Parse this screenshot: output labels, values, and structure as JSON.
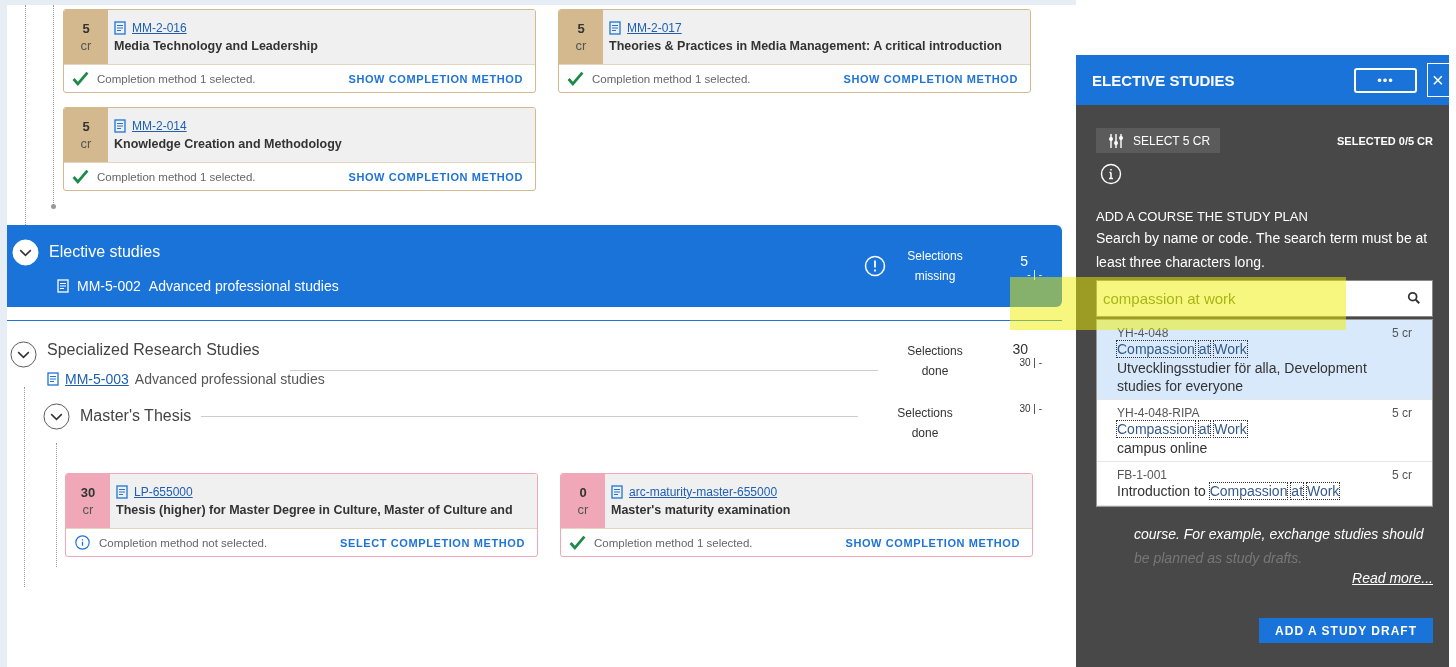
{
  "top_group": {
    "cards": [
      {
        "credits": "5",
        "unit": "cr",
        "code": "MM-2-016",
        "title": "Media Technology and Leadership",
        "color": "#d4b98e",
        "completion_selected": true,
        "status": "Completion method 1 selected.",
        "action": "SHOW COMPLETION METHOD"
      },
      {
        "credits": "5",
        "unit": "cr",
        "code": "MM-2-017",
        "title": "Theories & Practices in Media Management: A critical introduction",
        "color": "#d4b98e",
        "completion_selected": true,
        "status": "Completion method 1 selected.",
        "action": "SHOW COMPLETION METHOD"
      },
      {
        "credits": "5",
        "unit": "cr",
        "code": "MM-2-014",
        "title": "Knowledge Creation and Methodology",
        "color": "#d4b98e",
        "completion_selected": true,
        "status": "Completion method 1 selected.",
        "action": "SHOW COMPLETION METHOD"
      }
    ]
  },
  "elective": {
    "title": "Elective studies",
    "code": "MM-5-002",
    "name": "Advanced professional studies",
    "status": "Selections missing",
    "credits": "5",
    "range": "- | -"
  },
  "specialized": {
    "title": "Specialized Research Studies",
    "code": "MM-5-003",
    "name": "Advanced professional studies",
    "status": "Selections done",
    "credits": "30",
    "range": "30 | -",
    "children": [
      {
        "title": "Master's Thesis",
        "status": "Selections done",
        "range": "30 | -",
        "cards": [
          {
            "credits": "30",
            "unit": "cr",
            "code": "LP-655000",
            "title": "Thesis (higher) for Master Degree in Culture, Master of Culture and",
            "color": "#f0a8b8",
            "completion_selected": false,
            "status": "Completion method not selected.",
            "action": "SELECT COMPLETION METHOD"
          },
          {
            "credits": "0",
            "unit": "cr",
            "code": "arc-maturity-master-655000",
            "title": "Master's maturity examination",
            "color": "#f0a8b8",
            "completion_selected": true,
            "status": "Completion method 1 selected.",
            "action": "SHOW COMPLETION METHOD"
          }
        ]
      }
    ]
  },
  "panel": {
    "title": "ELECTIVE STUDIES",
    "more_button": "•••",
    "close_button": "×",
    "select_button": "SELECT 5 CR",
    "selected_count": "SELECTED 0/5 CR",
    "add_heading": "ADD A COURSE THE STUDY PLAN",
    "add_hint": "Search by name or code. The search term must be at least three characters long.",
    "search": {
      "value": "compassion at work"
    },
    "results": [
      {
        "code": "YH-4-048",
        "credits": "5 cr",
        "title": [
          {
            "text": "Compassion",
            "match": true
          },
          {
            "text": "at",
            "match": true
          },
          {
            "text": "Work",
            "match": true
          }
        ],
        "subtitle": "Utvecklingsstudier för alla, Development studies for everyone",
        "selected": true
      },
      {
        "code": "YH-4-048-RIPA",
        "credits": "5 cr",
        "title": [
          {
            "text": "Compassion",
            "match": true
          },
          {
            "text": "at",
            "match": true
          },
          {
            "text": "Work",
            "match": true
          }
        ],
        "subtitle": "campus online",
        "selected": false
      },
      {
        "code": "FB-1-001",
        "credits": "5 cr",
        "title": [
          {
            "text": "Introduction to",
            "match": false
          },
          {
            "text": "Compassion",
            "match": true
          },
          {
            "text": "at",
            "match": true
          },
          {
            "text": "Work",
            "match": true
          }
        ],
        "selected": false
      }
    ],
    "note_lines": [
      "course. For example, exchange studies should",
      "be planned as study drafts."
    ],
    "read_more": "Read more...",
    "draft_button": "ADD A STUDY DRAFT"
  }
}
